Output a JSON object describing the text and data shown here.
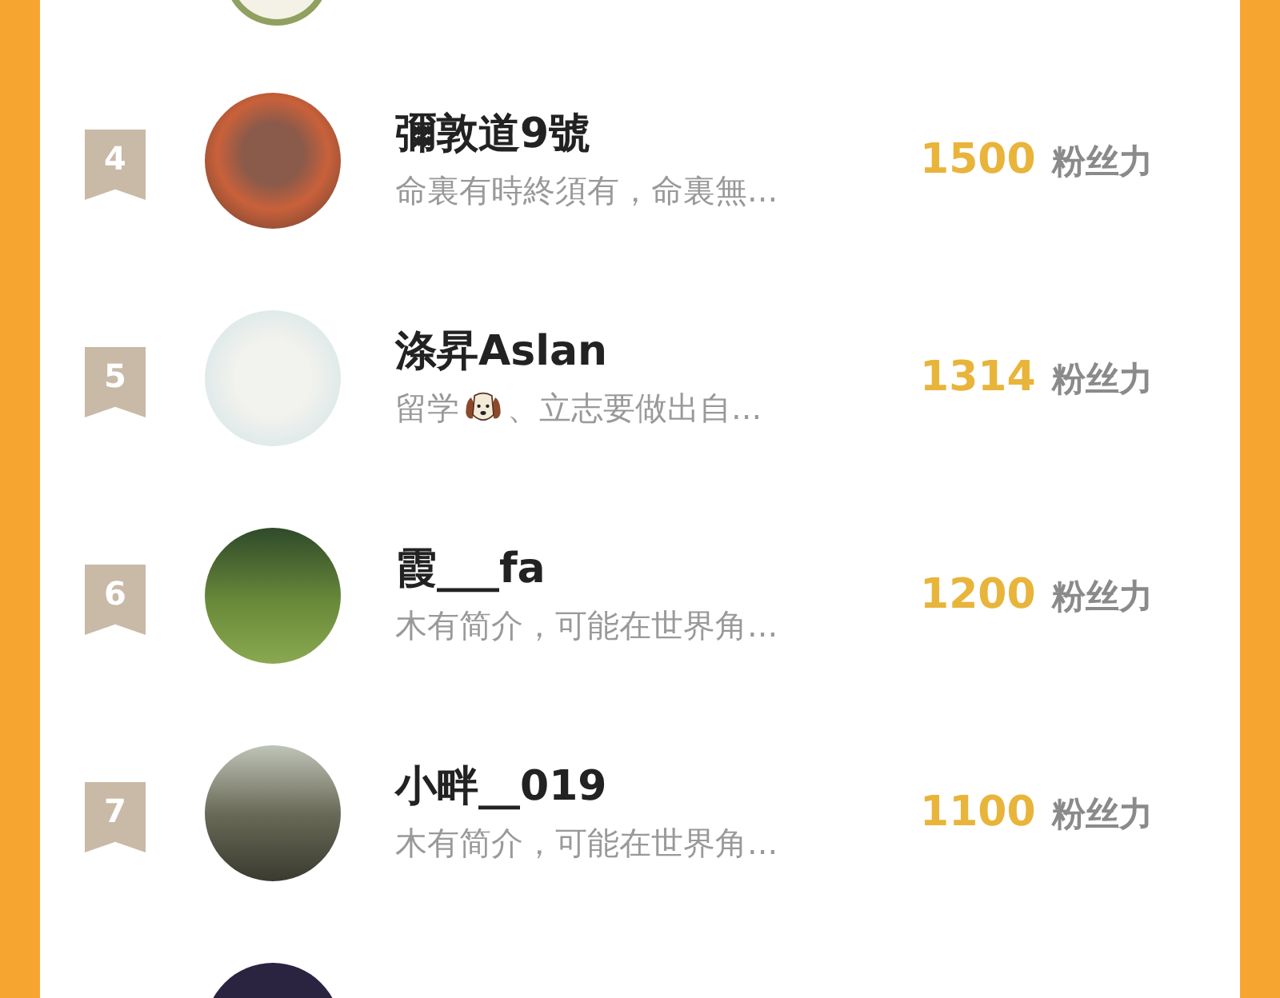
{
  "rows": [
    {
      "rank": "4",
      "name": "彌敦道9號",
      "bio": [
        {
          "kind": "text",
          "text": "命裏有時終須有，命裏無..."
        }
      ],
      "score": "1500",
      "score_unit": "粉丝力"
    },
    {
      "rank": "5",
      "name": "涤昇Aslan",
      "bio": [
        {
          "kind": "text",
          "text": "留学"
        },
        {
          "kind": "dog_emoji"
        },
        {
          "kind": "text",
          "text": "、立志要做出自..."
        }
      ],
      "score": "1314",
      "score_unit": "粉丝力"
    },
    {
      "rank": "6",
      "name": "霞___fa",
      "bio": [
        {
          "kind": "text",
          "text": "木有简介，可能在世界角..."
        }
      ],
      "score": "1200",
      "score_unit": "粉丝力"
    },
    {
      "rank": "7",
      "name": "小畔__019",
      "bio": [
        {
          "kind": "text",
          "text": "木有简介，可能在世界角..."
        }
      ],
      "score": "1100",
      "score_unit": "粉丝力"
    }
  ]
}
